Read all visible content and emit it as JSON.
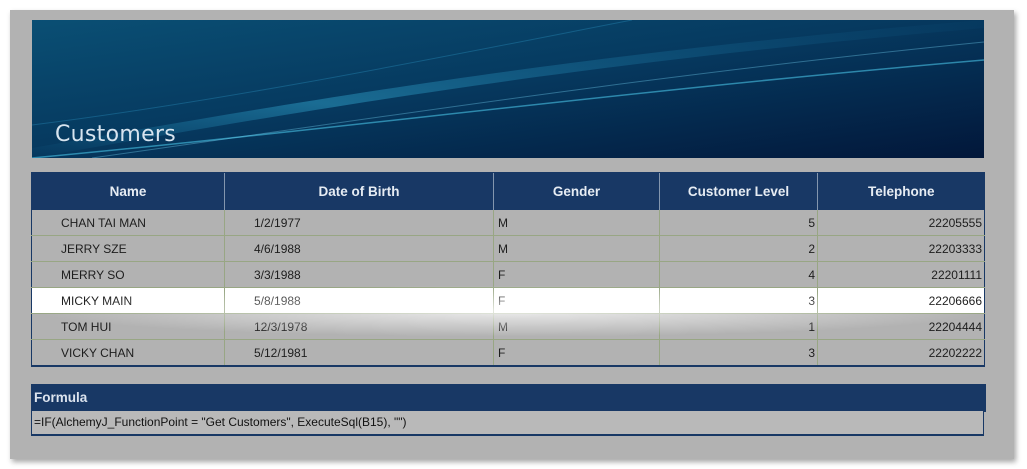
{
  "banner": {
    "title": "Customers"
  },
  "table": {
    "headers": [
      "Name",
      "Date of Birth",
      "Gender",
      "Customer Level",
      "Telephone"
    ],
    "rows": [
      [
        "CHAN TAI MAN",
        "1/2/1977",
        "M",
        "5",
        "22205555"
      ],
      [
        "JERRY SZE",
        "4/6/1988",
        "M",
        "2",
        "22203333"
      ],
      [
        "MERRY SO",
        "3/3/1988",
        "F",
        "4",
        "22201111"
      ],
      [
        "MICKY MAIN",
        "5/8/1988",
        "F",
        "3",
        "22206666"
      ],
      [
        "TOM HUI",
        "12/3/1978",
        "M",
        "1",
        "22204444"
      ],
      [
        "VICKY CHAN",
        "5/12/1981",
        "F",
        "3",
        "22202222"
      ]
    ]
  },
  "formula": {
    "label": "Formula",
    "text": "=IF(AlchemyJ_FunctionPoint = \"Get Customers\", ExecuteSql(B15), \"\")"
  },
  "colors": {
    "frame": "#b2b2b2",
    "header": "#183865",
    "banner": "#042a47"
  }
}
